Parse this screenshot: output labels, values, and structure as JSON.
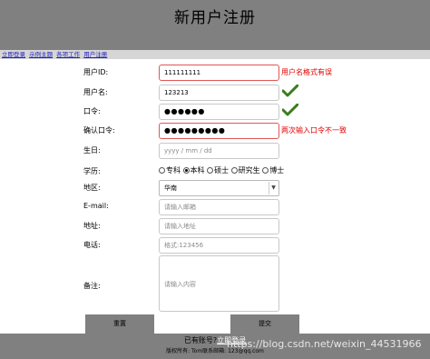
{
  "header": {
    "title": "新用户注册"
  },
  "nav": {
    "links": [
      "立即登录",
      "示例主题",
      "各项工作",
      "用户注册"
    ]
  },
  "form": {
    "userid": {
      "label": "用户ID:",
      "value": "111111111",
      "error": "用户名格式有误"
    },
    "username": {
      "label": "用户名:",
      "value": "123213"
    },
    "password": {
      "label": "口令:",
      "value": "●●●●●●"
    },
    "confirm": {
      "label": "确认口令:",
      "value": "●●●●●●●●●",
      "error": "两次输入口令不一致"
    },
    "birthday": {
      "label": "生日:",
      "placeholder": "yyyy / mm / dd"
    },
    "education": {
      "label": "学历:",
      "options": [
        "专科",
        "本科",
        "硕士",
        "研究生",
        "博士"
      ],
      "selected": "本科"
    },
    "region": {
      "label": "地区:",
      "value": "华南"
    },
    "email": {
      "label": "E-mail:",
      "placeholder": "请输入邮箱"
    },
    "address": {
      "label": "地址:",
      "placeholder": "请输入地址"
    },
    "phone": {
      "label": "电话:",
      "placeholder": "格式:123456"
    },
    "remark": {
      "label": "备注:",
      "placeholder": "请输入内容"
    }
  },
  "buttons": {
    "reset": "重置",
    "submit": "提交"
  },
  "footer": {
    "login_prefix": "已有账号?",
    "login_link": "立即登录",
    "copyright": "版权所有: Tom联系邮箱: 123@qq.com"
  },
  "watermark": "https://blog.csdn.net/weixin_44531966",
  "colors": {
    "header_bg": "#808080",
    "error": "#e00000",
    "check": "#3a7d1e"
  }
}
